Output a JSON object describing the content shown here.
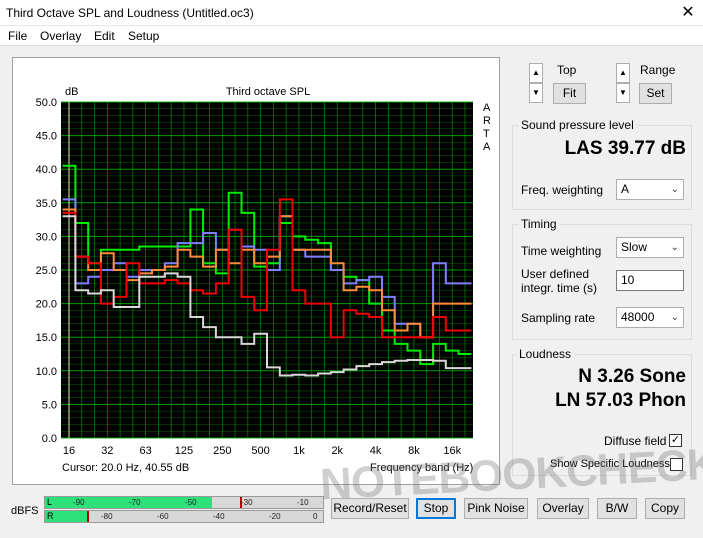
{
  "window": {
    "title": "Third Octave SPL and Loudness (Untitled.oc3)",
    "close_glyph": "✕"
  },
  "menu": [
    {
      "label": "File"
    },
    {
      "label": "Overlay"
    },
    {
      "label": "Edit"
    },
    {
      "label": "Setup"
    }
  ],
  "plot": {
    "unit": "dB",
    "title": "Third octave SPL",
    "side_letters": [
      "A",
      "R",
      "T",
      "A"
    ],
    "x_label": "Frequency band (Hz)",
    "cursor_readout": "Cursor:    20.0 Hz, 40.55 dB"
  },
  "chart_data": {
    "type": "line",
    "title": "Third octave SPL",
    "ylabel": "dB",
    "xlabel": "Frequency band (Hz)",
    "ylim": [
      0,
      50
    ],
    "grid": true,
    "background": "#000000",
    "grid_color": "#00b000",
    "y_ticks": [
      "50.0",
      "45.0",
      "40.0",
      "35.0",
      "30.0",
      "25.0",
      "20.0",
      "15.0",
      "10.0",
      "5.0",
      "0.0"
    ],
    "x_ticks": [
      "16",
      "32",
      "63",
      "125",
      "250",
      "500",
      "1k",
      "2k",
      "4k",
      "8k",
      "16k"
    ],
    "bands": [
      "16",
      "20",
      "25",
      "31.5",
      "40",
      "50",
      "63",
      "80",
      "100",
      "125",
      "160",
      "200",
      "250",
      "315",
      "400",
      "500",
      "630",
      "800",
      "1k",
      "1.25k",
      "1.6k",
      "2k",
      "2.5k",
      "3.15k",
      "4k",
      "5k",
      "6.3k",
      "8k",
      "10k",
      "12.5k",
      "16k",
      "20k"
    ],
    "series": [
      {
        "color": "#00ee00",
        "values": [
          40.5,
          32,
          26,
          28,
          28,
          28,
          28.5,
          28.5,
          28.5,
          28.5,
          34,
          26,
          24.5,
          36.5,
          33.5,
          25.5,
          26,
          32,
          30,
          29.5,
          29,
          25,
          24,
          23.5,
          20,
          16,
          14,
          13,
          11,
          14,
          13,
          12.5
        ]
      },
      {
        "color": "#8080ff",
        "values": [
          35.5,
          23,
          24,
          25,
          26,
          24,
          25,
          25,
          26,
          29,
          29,
          30.5,
          28,
          31,
          28.5,
          28,
          25,
          33,
          28,
          27,
          27,
          25,
          23,
          23.5,
          24,
          21,
          17,
          17,
          15,
          26,
          23,
          23
        ]
      },
      {
        "color": "#ff8c3c",
        "values": [
          34,
          27,
          25,
          27.5,
          25,
          23.5,
          24.5,
          25,
          25.5,
          28,
          27,
          25.5,
          28,
          26,
          28,
          26,
          27,
          33,
          28,
          28,
          28,
          26,
          22,
          22.5,
          22,
          19,
          16,
          17,
          15,
          20,
          20,
          20
        ]
      },
      {
        "color": "#ee0000",
        "values": [
          33.5,
          27,
          26,
          20,
          21,
          26,
          23,
          23,
          23.5,
          23,
          22,
          21.5,
          23,
          31,
          21,
          19,
          28,
          35.5,
          22,
          20,
          20,
          15,
          19,
          18.5,
          18,
          15,
          15,
          15,
          15,
          18,
          16,
          16
        ]
      },
      {
        "color": "#d8d8d8",
        "values": [
          33,
          22,
          21.5,
          22,
          19.5,
          19.5,
          24,
          24,
          24.5,
          24,
          18,
          16.5,
          15,
          15,
          14,
          15.5,
          10.5,
          9.3,
          9.4,
          9.3,
          9.6,
          9.8,
          10.2,
          10.7,
          11,
          11.3,
          11.5,
          11.6,
          11.6,
          11.5,
          10.4,
          10.4
        ]
      }
    ]
  },
  "controls": {
    "top_label": "Top",
    "range_label": "Range",
    "fit_label": "Fit",
    "set_label": "Set",
    "up": "▲",
    "down": "▼"
  },
  "spl": {
    "title": "Sound pressure level",
    "value": "LAS 39.77 dB",
    "freq_weighting_label": "Freq. weighting",
    "freq_weighting_value": "A"
  },
  "timing": {
    "title": "Timing",
    "time_weighting_label": "Time weighting",
    "time_weighting_value": "Slow",
    "user_defined_label_1": "User defined",
    "user_defined_label_2": "integr. time (s)",
    "integr_time_value": "10",
    "sampling_rate_label": "Sampling rate",
    "sampling_rate_value": "48000"
  },
  "loudness": {
    "title": "Loudness",
    "n_value": "N 3.26 Sone",
    "ln_value": "LN 57.03 Phon",
    "diffuse_field_label": "Diffuse field",
    "diffuse_field_checked": "✓",
    "show_specific_label": "Show Specific Loudness"
  },
  "meter": {
    "label": "dBFS",
    "left_channel": "L",
    "right_channel": "R",
    "left_ticks": [
      "-90",
      "-70",
      "-50",
      "-30",
      "-10"
    ],
    "right_ticks": [
      "-80",
      "-60",
      "-40",
      "-20",
      "0"
    ],
    "left_level_fraction": 0.6,
    "right_level_fraction": 0.15,
    "left_peak_fraction": 0.7,
    "right_peak_fraction": 0.15
  },
  "buttons": {
    "record_reset": "Record/Reset",
    "stop": "Stop",
    "pink_noise": "Pink Noise",
    "overlay": "Overlay",
    "bw": "B/W",
    "copy": "Copy"
  },
  "watermark": "NOTEBOOKCHECK"
}
